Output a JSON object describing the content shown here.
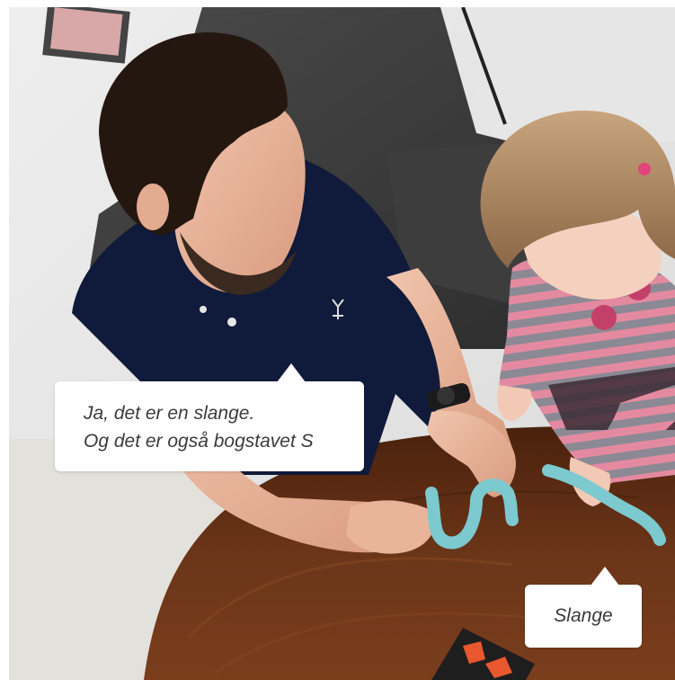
{
  "speech": {
    "father": {
      "line1": "Ja, det er en slange.",
      "line2": "Og det er også bogstavet S"
    },
    "child_label": "Slange"
  },
  "colors": {
    "background": "#ffffff",
    "table_wood": "#6b3519",
    "father_shirt": "#101a3a",
    "child_sweater_stripes": [
      "#e48aa0",
      "#8b8994"
    ],
    "playdough": "#7cc9cf",
    "bubble": "#ffffff",
    "bubble_text": "#3b3b3b"
  }
}
